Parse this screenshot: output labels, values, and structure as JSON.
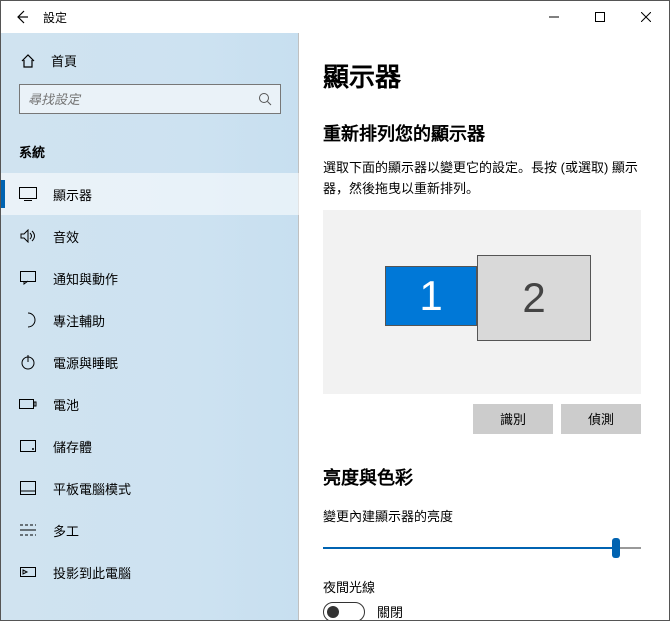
{
  "titlebar": {
    "back_aria": "back",
    "title": "設定"
  },
  "sidebar": {
    "home_label": "首頁",
    "search_placeholder": "尋找設定",
    "section_label": "系統",
    "items": [
      {
        "id": "display",
        "label": "顯示器",
        "selected": true
      },
      {
        "id": "sound",
        "label": "音效",
        "selected": false
      },
      {
        "id": "notifications",
        "label": "通知與動作",
        "selected": false
      },
      {
        "id": "focus",
        "label": "專注輔助",
        "selected": false
      },
      {
        "id": "power",
        "label": "電源與睡眠",
        "selected": false
      },
      {
        "id": "battery",
        "label": "電池",
        "selected": false
      },
      {
        "id": "storage",
        "label": "儲存體",
        "selected": false
      },
      {
        "id": "tablet",
        "label": "平板電腦模式",
        "selected": false
      },
      {
        "id": "multitask",
        "label": "多工",
        "selected": false
      },
      {
        "id": "project",
        "label": "投影到此電腦",
        "selected": false
      }
    ]
  },
  "main": {
    "heading": "顯示器",
    "arrange": {
      "heading": "重新排列您的顯示器",
      "hint": "選取下面的顯示器以變更它的設定。長按 (或選取) 顯示器，然後拖曳以重新排列。",
      "monitors": {
        "1": "1",
        "2": "2"
      },
      "identify_btn": "識別",
      "detect_btn": "偵測"
    },
    "brightness": {
      "heading": "亮度與色彩",
      "slider_label": "變更內建顯示器的亮度",
      "nightlight_label": "夜間光線",
      "nightlight_state": "關閉"
    }
  }
}
